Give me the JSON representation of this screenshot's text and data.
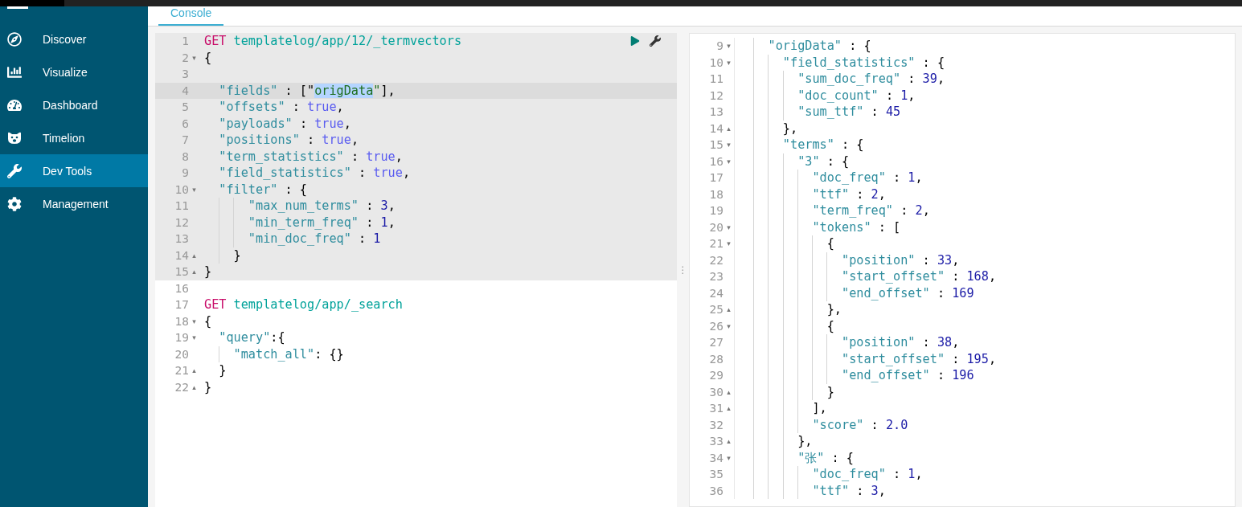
{
  "sidebar": {
    "items": [
      {
        "label": "Discover",
        "selected": false
      },
      {
        "label": "Visualize",
        "selected": false
      },
      {
        "label": "Dashboard",
        "selected": false
      },
      {
        "label": "Timelion",
        "selected": false
      },
      {
        "label": "Dev Tools",
        "selected": true
      },
      {
        "label": "Management",
        "selected": false
      }
    ]
  },
  "tabs": [
    {
      "label": "Console",
      "selected": true
    }
  ],
  "request_editor": {
    "lines": [
      {
        "n": "1",
        "in_request": true,
        "active": false,
        "tokens": [
          {
            "kind": "method",
            "text": "GET"
          },
          {
            "kind": "url",
            "text": " templatelog/app/12/_termvectors"
          }
        ]
      },
      {
        "n": "2",
        "fold_marker": "▾",
        "in_request": true,
        "active": false,
        "tokens": [
          {
            "kind": "punct",
            "text": "{"
          }
        ]
      },
      {
        "n": "3",
        "in_request": true,
        "active": false
      },
      {
        "n": "4",
        "in_request": true,
        "active": true,
        "tokens": [
          {
            "kind": "key",
            "text": "  \"fields\""
          },
          {
            "kind": "punct",
            "text": " : [\""
          },
          {
            "kind": "selection",
            "text": "origData"
          },
          {
            "kind": "string",
            "text": "\""
          },
          {
            "kind": "punct",
            "text": "],"
          }
        ]
      },
      {
        "n": "5",
        "in_request": true,
        "active": false,
        "tokens": [
          {
            "kind": "key",
            "text": "  \"offsets\""
          },
          {
            "kind": "punct",
            "text": " : "
          },
          {
            "kind": "bool",
            "text": "true"
          },
          {
            "kind": "punct",
            "text": ","
          }
        ]
      },
      {
        "n": "6",
        "in_request": true,
        "active": false,
        "tokens": [
          {
            "kind": "key",
            "text": "  \"payloads\""
          },
          {
            "kind": "punct",
            "text": " : "
          },
          {
            "kind": "bool",
            "text": "true"
          },
          {
            "kind": "punct",
            "text": ","
          }
        ]
      },
      {
        "n": "7",
        "in_request": true,
        "active": false,
        "tokens": [
          {
            "kind": "key",
            "text": "  \"positions\""
          },
          {
            "kind": "punct",
            "text": " : "
          },
          {
            "kind": "bool",
            "text": "true"
          },
          {
            "kind": "punct",
            "text": ","
          }
        ]
      },
      {
        "n": "8",
        "in_request": true,
        "active": false,
        "tokens": [
          {
            "kind": "key",
            "text": "  \"term_statistics\""
          },
          {
            "kind": "punct",
            "text": " : "
          },
          {
            "kind": "bool",
            "text": "true"
          },
          {
            "kind": "punct",
            "text": ","
          }
        ]
      },
      {
        "n": "9",
        "in_request": true,
        "active": false,
        "tokens": [
          {
            "kind": "key",
            "text": "  \"field_statistics\""
          },
          {
            "kind": "punct",
            "text": " : "
          },
          {
            "kind": "bool",
            "text": "true"
          },
          {
            "kind": "punct",
            "text": ","
          }
        ]
      },
      {
        "n": "10",
        "fold_marker": "▾",
        "in_request": true,
        "active": false,
        "tokens": [
          {
            "kind": "key",
            "text": "  \"filter\""
          },
          {
            "kind": "punct",
            "text": " : {"
          }
        ]
      },
      {
        "n": "11",
        "in_request": true,
        "active": false,
        "tokens": [
          {
            "kind": "key",
            "text": "      \"max_num_terms\""
          },
          {
            "kind": "punct",
            "text": " : "
          },
          {
            "kind": "number",
            "text": "3"
          },
          {
            "kind": "punct",
            "text": ","
          }
        ]
      },
      {
        "n": "12",
        "in_request": true,
        "active": false,
        "tokens": [
          {
            "kind": "key",
            "text": "      \"min_term_freq\""
          },
          {
            "kind": "punct",
            "text": " : "
          },
          {
            "kind": "number",
            "text": "1"
          },
          {
            "kind": "punct",
            "text": ","
          }
        ]
      },
      {
        "n": "13",
        "in_request": true,
        "active": false,
        "tokens": [
          {
            "kind": "key",
            "text": "      \"min_doc_freq\""
          },
          {
            "kind": "punct",
            "text": " : "
          },
          {
            "kind": "number",
            "text": "1"
          }
        ]
      },
      {
        "n": "14",
        "fold_marker": "▴",
        "in_request": true,
        "active": false,
        "tokens": [
          {
            "kind": "punct",
            "text": "    }"
          }
        ]
      },
      {
        "n": "15",
        "fold_marker": "▴",
        "in_request": true,
        "active": false,
        "tokens": [
          {
            "kind": "punct",
            "text": "}"
          }
        ]
      },
      {
        "n": "16",
        "in_request": false,
        "active": false
      },
      {
        "n": "17",
        "in_request": false,
        "active": false,
        "tokens": [
          {
            "kind": "method",
            "text": "GET"
          },
          {
            "kind": "url",
            "text": " templatelog/app/_search"
          }
        ]
      },
      {
        "n": "18",
        "fold_marker": "▾",
        "in_request": false,
        "active": false,
        "tokens": [
          {
            "kind": "punct",
            "text": "{"
          }
        ]
      },
      {
        "n": "19",
        "fold_marker": "▾",
        "in_request": false,
        "active": false,
        "tokens": [
          {
            "kind": "key",
            "text": "  \"query\""
          },
          {
            "kind": "punct",
            "text": ":{"
          }
        ]
      },
      {
        "n": "20",
        "in_request": false,
        "active": false,
        "tokens": [
          {
            "kind": "key",
            "text": "    \"match_all\""
          },
          {
            "kind": "punct",
            "text": ": {}"
          }
        ]
      },
      {
        "n": "21",
        "fold_marker": "▴",
        "in_request": false,
        "active": false,
        "tokens": [
          {
            "kind": "punct",
            "text": "  }"
          }
        ]
      },
      {
        "n": "22",
        "fold_marker": "▴",
        "in_request": false,
        "active": false,
        "tokens": [
          {
            "kind": "punct",
            "text": "}"
          }
        ]
      }
    ]
  },
  "resizer": {
    "grip": "⋮"
  },
  "response_viewer": {
    "lines": [
      {
        "n": "9",
        "fold_marker": "▾",
        "tokens": [
          {
            "kind": "key",
            "text": "    \"origData\""
          },
          {
            "kind": "punct",
            "text": " : {"
          }
        ]
      },
      {
        "n": "10",
        "fold_marker": "▾",
        "tokens": [
          {
            "kind": "key",
            "text": "      \"field_statistics\""
          },
          {
            "kind": "punct",
            "text": " : {"
          }
        ]
      },
      {
        "n": "11",
        "tokens": [
          {
            "kind": "key",
            "text": "        \"sum_doc_freq\""
          },
          {
            "kind": "punct",
            "text": " : "
          },
          {
            "kind": "number",
            "text": "39"
          },
          {
            "kind": "punct",
            "text": ","
          }
        ]
      },
      {
        "n": "12",
        "tokens": [
          {
            "kind": "key",
            "text": "        \"doc_count\""
          },
          {
            "kind": "punct",
            "text": " : "
          },
          {
            "kind": "number",
            "text": "1"
          },
          {
            "kind": "punct",
            "text": ","
          }
        ]
      },
      {
        "n": "13",
        "tokens": [
          {
            "kind": "key",
            "text": "        \"sum_ttf\""
          },
          {
            "kind": "punct",
            "text": " : "
          },
          {
            "kind": "number",
            "text": "45"
          }
        ]
      },
      {
        "n": "14",
        "fold_marker": "▴",
        "tokens": [
          {
            "kind": "punct",
            "text": "      },"
          }
        ]
      },
      {
        "n": "15",
        "fold_marker": "▾",
        "tokens": [
          {
            "kind": "key",
            "text": "      \"terms\""
          },
          {
            "kind": "punct",
            "text": " : {"
          }
        ]
      },
      {
        "n": "16",
        "fold_marker": "▾",
        "tokens": [
          {
            "kind": "key",
            "text": "        \"3\""
          },
          {
            "kind": "punct",
            "text": " : {"
          }
        ]
      },
      {
        "n": "17",
        "tokens": [
          {
            "kind": "key",
            "text": "          \"doc_freq\""
          },
          {
            "kind": "punct",
            "text": " : "
          },
          {
            "kind": "number",
            "text": "1"
          },
          {
            "kind": "punct",
            "text": ","
          }
        ]
      },
      {
        "n": "18",
        "tokens": [
          {
            "kind": "key",
            "text": "          \"ttf\""
          },
          {
            "kind": "punct",
            "text": " : "
          },
          {
            "kind": "number",
            "text": "2"
          },
          {
            "kind": "punct",
            "text": ","
          }
        ]
      },
      {
        "n": "19",
        "tokens": [
          {
            "kind": "key",
            "text": "          \"term_freq\""
          },
          {
            "kind": "punct",
            "text": " : "
          },
          {
            "kind": "number",
            "text": "2"
          },
          {
            "kind": "punct",
            "text": ","
          }
        ]
      },
      {
        "n": "20",
        "fold_marker": "▾",
        "tokens": [
          {
            "kind": "key",
            "text": "          \"tokens\""
          },
          {
            "kind": "punct",
            "text": " : ["
          }
        ]
      },
      {
        "n": "21",
        "fold_marker": "▾",
        "tokens": [
          {
            "kind": "punct",
            "text": "            {"
          }
        ]
      },
      {
        "n": "22",
        "tokens": [
          {
            "kind": "key",
            "text": "              \"position\""
          },
          {
            "kind": "punct",
            "text": " : "
          },
          {
            "kind": "number",
            "text": "33"
          },
          {
            "kind": "punct",
            "text": ","
          }
        ]
      },
      {
        "n": "23",
        "tokens": [
          {
            "kind": "key",
            "text": "              \"start_offset\""
          },
          {
            "kind": "punct",
            "text": " : "
          },
          {
            "kind": "number",
            "text": "168"
          },
          {
            "kind": "punct",
            "text": ","
          }
        ]
      },
      {
        "n": "24",
        "tokens": [
          {
            "kind": "key",
            "text": "              \"end_offset\""
          },
          {
            "kind": "punct",
            "text": " : "
          },
          {
            "kind": "number",
            "text": "169"
          }
        ]
      },
      {
        "n": "25",
        "fold_marker": "▴",
        "tokens": [
          {
            "kind": "punct",
            "text": "            },"
          }
        ]
      },
      {
        "n": "26",
        "fold_marker": "▾",
        "tokens": [
          {
            "kind": "punct",
            "text": "            {"
          }
        ]
      },
      {
        "n": "27",
        "tokens": [
          {
            "kind": "key",
            "text": "              \"position\""
          },
          {
            "kind": "punct",
            "text": " : "
          },
          {
            "kind": "number",
            "text": "38"
          },
          {
            "kind": "punct",
            "text": ","
          }
        ]
      },
      {
        "n": "28",
        "tokens": [
          {
            "kind": "key",
            "text": "              \"start_offset\""
          },
          {
            "kind": "punct",
            "text": " : "
          },
          {
            "kind": "number",
            "text": "195"
          },
          {
            "kind": "punct",
            "text": ","
          }
        ]
      },
      {
        "n": "29",
        "tokens": [
          {
            "kind": "key",
            "text": "              \"end_offset\""
          },
          {
            "kind": "punct",
            "text": " : "
          },
          {
            "kind": "number",
            "text": "196"
          }
        ]
      },
      {
        "n": "30",
        "fold_marker": "▴",
        "tokens": [
          {
            "kind": "punct",
            "text": "            }"
          }
        ]
      },
      {
        "n": "31",
        "fold_marker": "▴",
        "tokens": [
          {
            "kind": "punct",
            "text": "          ],"
          }
        ]
      },
      {
        "n": "32",
        "tokens": [
          {
            "kind": "key",
            "text": "          \"score\""
          },
          {
            "kind": "punct",
            "text": " : "
          },
          {
            "kind": "number",
            "text": "2.0"
          }
        ]
      },
      {
        "n": "33",
        "fold_marker": "▴",
        "tokens": [
          {
            "kind": "punct",
            "text": "        },"
          }
        ]
      },
      {
        "n": "34",
        "fold_marker": "▾",
        "tokens": [
          {
            "kind": "key",
            "text": "        \"张\""
          },
          {
            "kind": "punct",
            "text": " : {"
          }
        ]
      },
      {
        "n": "35",
        "tokens": [
          {
            "kind": "key",
            "text": "          \"doc_freq\""
          },
          {
            "kind": "punct",
            "text": " : "
          },
          {
            "kind": "number",
            "text": "1"
          },
          {
            "kind": "punct",
            "text": ","
          }
        ]
      },
      {
        "n": "36",
        "tokens": [
          {
            "kind": "key",
            "text": "          \"ttf\""
          },
          {
            "kind": "punct",
            "text": " : "
          },
          {
            "kind": "number",
            "text": "3"
          },
          {
            "kind": "punct",
            "text": ","
          }
        ]
      }
    ]
  }
}
